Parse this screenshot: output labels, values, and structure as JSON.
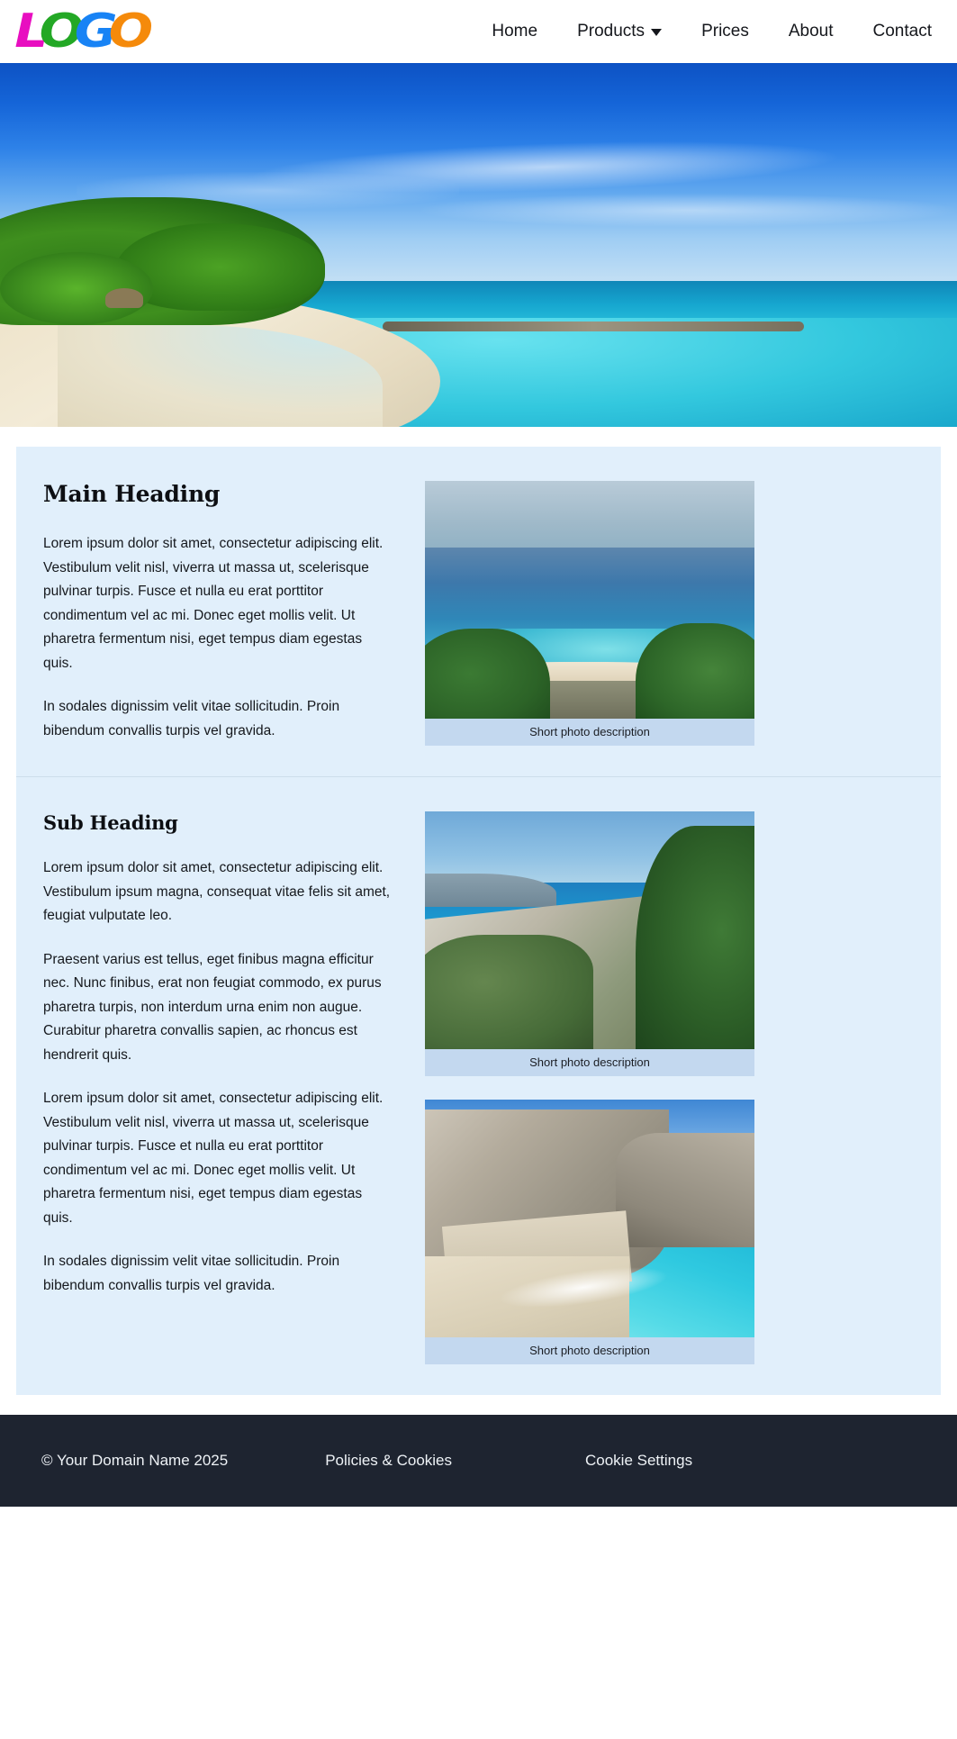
{
  "header": {
    "logo": {
      "letters": [
        {
          "char": "L",
          "color": "#e80ec0"
        },
        {
          "char": "O",
          "color": "#23a825"
        },
        {
          "char": "G",
          "color": "#1883f5"
        },
        {
          "char": "O",
          "color": "#f58a0b"
        }
      ]
    },
    "nav": [
      {
        "label": "Home",
        "has_dropdown": false
      },
      {
        "label": "Products",
        "has_dropdown": true
      },
      {
        "label": "Prices",
        "has_dropdown": false
      },
      {
        "label": "About",
        "has_dropdown": false
      },
      {
        "label": "Contact",
        "has_dropdown": false
      }
    ]
  },
  "hero": {
    "alt": "tropical-beach-lagoon-banner"
  },
  "main": {
    "sections": [
      {
        "heading": "Main Heading",
        "paragraphs": [
          "Lorem ipsum dolor sit amet, consectetur adipiscing elit. Vestibulum velit nisl, viverra ut massa ut, scelerisque pulvinar turpis. Fusce et nulla eu erat porttitor condimentum vel ac mi. Donec eget mollis velit. Ut pharetra fermentum nisi, eget tempus diam egestas quis.",
          "In sodales dignissim velit vitae sollicitudin. Proin bibendum convallis turpis vel gravida."
        ],
        "figures": [
          {
            "caption": "Short photo description",
            "alt": "aerial-view-of-turquoise-bay-with-trees"
          }
        ]
      },
      {
        "heading": "Sub Heading",
        "paragraphs": [
          "Lorem ipsum dolor sit amet, consectetur adipiscing elit. Vestibulum ipsum magna, consequat vitae felis sit amet, feugiat vulputate leo.",
          "Praesent varius est tellus, eget finibus magna efficitur nec. Nunc finibus, erat non feugiat commodo, ex purus pharetra turpis, non interdum urna enim non augue. Curabitur pharetra convallis sapien, ac rhoncus est hendrerit quis.",
          "Lorem ipsum dolor sit amet, consectetur adipiscing elit. Vestibulum velit nisl, viverra ut massa ut, scelerisque pulvinar turpis. Fusce et nulla eu erat porttitor condimentum vel ac mi. Donec eget mollis velit. Ut pharetra fermentum nisi, eget tempus diam egestas quis.",
          "In sodales dignissim velit vitae sollicitudin. Proin bibendum convallis turpis vel gravida."
        ],
        "figures": [
          {
            "caption": "Short photo description",
            "alt": "rocky-coastline-with-pine-tree"
          },
          {
            "caption": "Short photo description",
            "alt": "white-cliff-beach-with-turquoise-water"
          }
        ]
      }
    ]
  },
  "footer": {
    "copyright": "© Your Domain Name 2025",
    "policies_label": "Policies & Cookies",
    "cookie_settings_label": "Cookie Settings"
  },
  "colors": {
    "card_background": "#e1effb",
    "caption_background": "#c3d8ef",
    "footer_background": "#1e2430",
    "page_background": "#ffffff",
    "divider": "#cdddea"
  }
}
